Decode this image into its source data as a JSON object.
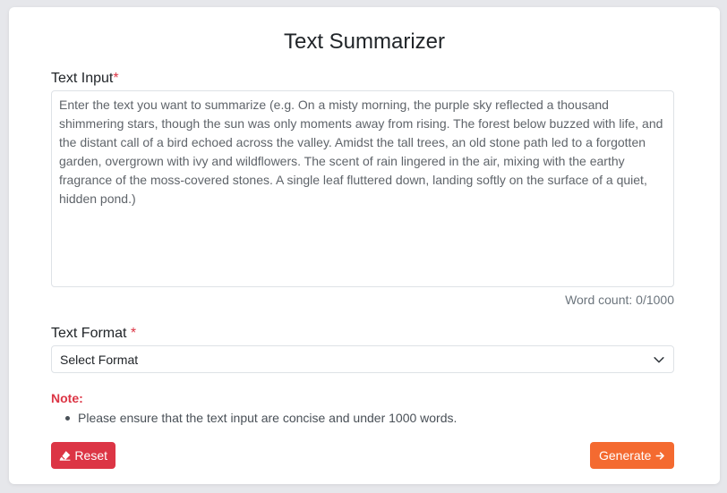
{
  "title": "Text Summarizer",
  "text_input": {
    "label": "Text Input",
    "required_mark": "*",
    "placeholder": "Enter the text you want to summarize (e.g. On a misty morning, the purple sky reflected a thousand shimmering stars, though the sun was only moments away from rising. The forest below buzzed with life, and the distant call of a bird echoed across the valley. Amidst the tall trees, an old stone path led to a forgotten garden, overgrown with ivy and wildflowers. The scent of rain lingered in the air, mixing with the earthy fragrance of the moss-covered stones. A single leaf fluttered down, landing softly on the surface of a quiet, hidden pond.)",
    "value": "",
    "word_count": "Word count: 0/1000"
  },
  "text_format": {
    "label": "Text Format",
    "required_mark": "*",
    "selected": "Select Format"
  },
  "note": {
    "title": "Note:",
    "items": [
      "Please ensure that the text input are concise and under 1000 words."
    ]
  },
  "buttons": {
    "reset_label": "Reset",
    "generate_label": "Generate"
  },
  "colors": {
    "danger": "#dc3545",
    "accent": "#f46a30"
  },
  "icons": {
    "reset": "eraser-icon",
    "generate": "arrow-right-icon",
    "select": "chevron-down-icon"
  }
}
